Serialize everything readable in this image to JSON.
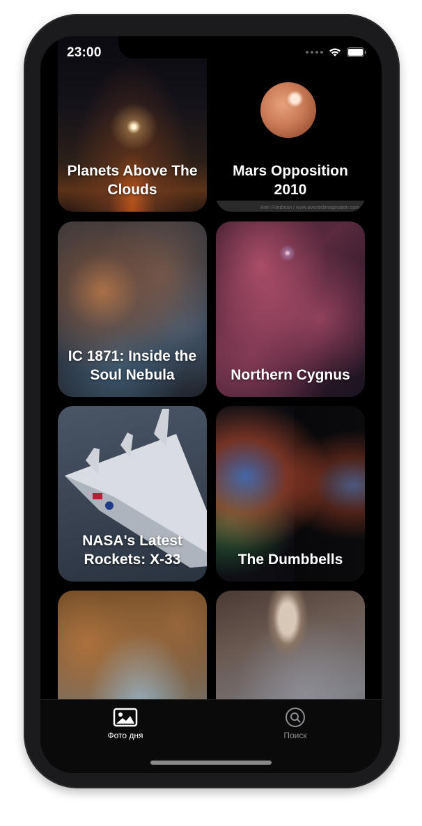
{
  "status_bar": {
    "time": "23:00"
  },
  "cards": [
    {
      "title": "Planets Above The Clouds",
      "credit": ""
    },
    {
      "title": "Mars Opposition 2010",
      "credit": "Alan Friedman / www.avertedimagination.com"
    },
    {
      "title": "IC 1871: Inside the Soul Nebula",
      "credit": ""
    },
    {
      "title": "Northern Cygnus",
      "credit": ""
    },
    {
      "title": "NASA's Latest Rockets: X-33",
      "credit": ""
    },
    {
      "title": "The Dumbbells",
      "credit": ""
    },
    {
      "title": "",
      "credit": ""
    },
    {
      "title": "",
      "credit": ""
    }
  ],
  "tabbar": {
    "tabs": [
      {
        "label": "Фото дня",
        "icon": "photo-icon",
        "selected": true
      },
      {
        "label": "Поиск",
        "icon": "search-icon",
        "selected": false
      }
    ]
  },
  "colors": {
    "background": "#000000",
    "tab_selected": "#ffffff",
    "tab_unselected": "#8e8e93"
  }
}
